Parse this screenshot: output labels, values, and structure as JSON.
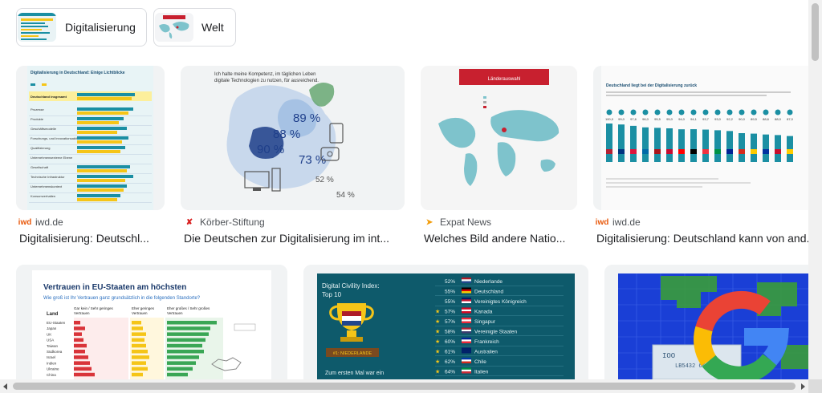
{
  "chips": [
    {
      "label": "Digitalisierung"
    },
    {
      "label": "Welt"
    }
  ],
  "results": [
    {
      "source": "iwd.de",
      "title": "Digitalisierung: Deutschl...",
      "image": {
        "heading": "Digitalisierung in Deutschland: Einige Lichtblicke",
        "highlight_row": "Deutschland insgesamt",
        "rows": [
          "Prozesse",
          "Produkte",
          "Geschäftsmodelle",
          "Forschungs- und Innovationsaktivitäten",
          "Qualifizierung",
          "Unternehmensexterne Ebene",
          "Gesellschaft",
          "Technische Infrastruktur",
          "Unternehmenskontext",
          "Konsumverhalten"
        ]
      }
    },
    {
      "source": "Körber-Stiftung",
      "title": "Die Deutschen zur Digitalisierung im int...",
      "image": {
        "caption": "Ich halte meine Kompetenz, im täglichen Leben digitale Technologien zu nutzen, für ausreichend.",
        "values": [
          "89 %",
          "88 %",
          "90 %",
          "73 %",
          "52 %",
          "54 %"
        ]
      }
    },
    {
      "source": "Expat News",
      "title": "Welches Bild andere Natio...",
      "image": {
        "banner": "Länderauswahl"
      }
    },
    {
      "source": "iwd.de",
      "title": "Digitalisierung: Deutschland kann von and...",
      "image": {
        "heading": "Deutschland liegt bei der Digitalisierung zurück",
        "values": [
          "100,0",
          "99,0",
          "97,6",
          "96,0",
          "95,5",
          "95,0",
          "94,0",
          "94,1",
          "93,7",
          "93,0",
          "92,2",
          "90,0",
          "89,5",
          "88,6",
          "88,0",
          "87,0"
        ]
      }
    },
    {
      "source": "",
      "title": "",
      "image": {
        "heading": "Vertrauen in EU-Staaten am höchsten",
        "subheading": "Wie groß ist Ihr Vertrauen ganz grundsätzlich in die folgenden Standorte?",
        "col_land": "Land",
        "col1": "Gar kein / Sehr geringes Vertrauen",
        "col2": "Eher geringes Vertrauen",
        "col3": "Eher großes / Sehr großes Vertrauen",
        "countries": [
          "EU-Staaten",
          "Japan",
          "UK",
          "USA",
          "Taiwan",
          "Südkorea",
          "Israel",
          "Indien",
          "Ukraine",
          "China"
        ]
      }
    },
    {
      "source": "",
      "title": "",
      "image": {
        "heading": "Digital Civility Index: Top 10",
        "badge": "#1: NIEDERLANDE",
        "footer": "Zum ersten Mal war ein",
        "rows": [
          {
            "pct": "52%",
            "country": "Niederlande"
          },
          {
            "pct": "55%",
            "country": "Deutschland"
          },
          {
            "pct": "55%",
            "country": "Vereinigtes Königreich"
          },
          {
            "pct": "57%",
            "country": "Kanada"
          },
          {
            "pct": "57%",
            "country": "Singapur"
          },
          {
            "pct": "58%",
            "country": "Vereinigte Staaten"
          },
          {
            "pct": "60%",
            "country": "Frankreich"
          },
          {
            "pct": "61%",
            "country": "Australien"
          },
          {
            "pct": "62%",
            "country": "Chile"
          },
          {
            "pct": "64%",
            "country": "Italien"
          }
        ]
      }
    },
    {
      "source": "",
      "title": "",
      "image": {
        "note": "Google logo over banknote"
      }
    }
  ],
  "colors": {
    "accent_teal": "#1b8fa3",
    "accent_yellow": "#f5c518",
    "dci_bg": "#0e5a6b",
    "google_blue": "#4285f4",
    "google_red": "#ea4335",
    "google_yellow": "#fbbc05",
    "google_green": "#34a853"
  }
}
